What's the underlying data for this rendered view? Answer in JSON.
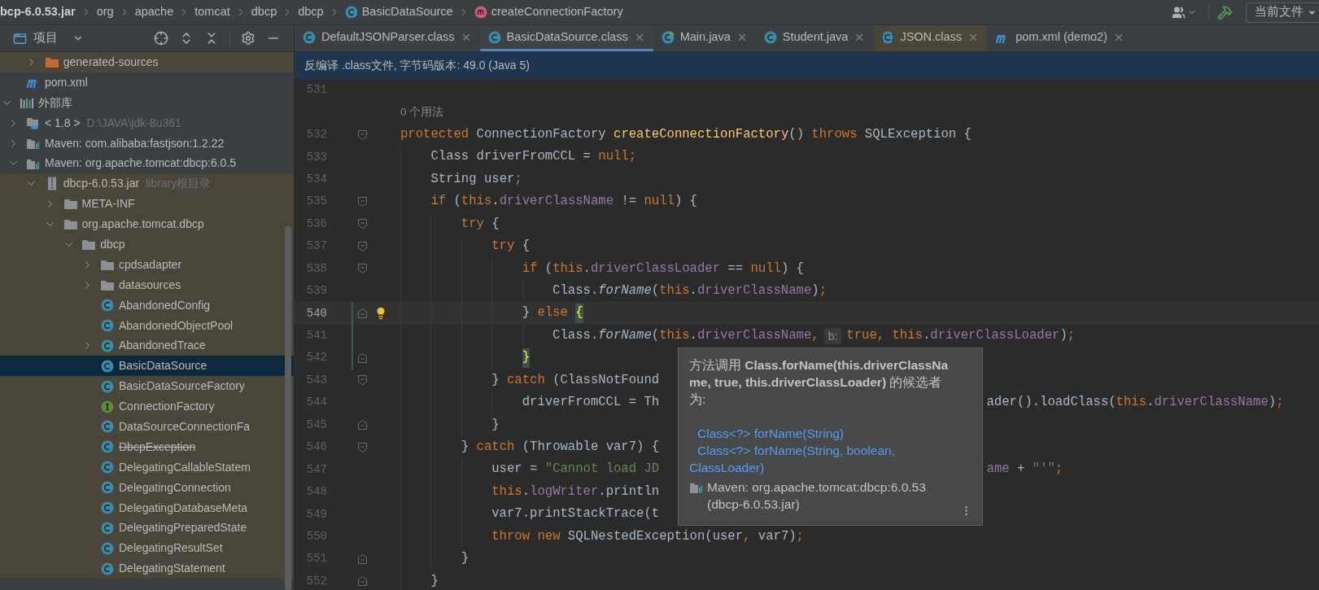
{
  "breadcrumb": [
    {
      "label": "bcp-6.0.53.jar",
      "kind": "jar"
    },
    {
      "label": "org",
      "kind": "package"
    },
    {
      "label": "apache",
      "kind": "package"
    },
    {
      "label": "tomcat",
      "kind": "package"
    },
    {
      "label": "dbcp",
      "kind": "package"
    },
    {
      "label": "dbcp",
      "kind": "package"
    },
    {
      "label": "BasicDataSource",
      "kind": "class"
    },
    {
      "label": "createConnectionFactory",
      "kind": "method"
    }
  ],
  "toolbar": {
    "scope": "当前文件"
  },
  "project_panel": {
    "title": "项目",
    "tree": [
      {
        "children": [
          {
            "children": [
              {
                "label": "generated-sources",
                "kind": "source-folder",
                "expanded": false,
                "selected": false,
                "tinted": true
              }
            ]
          },
          {
            "label": "pom.xml",
            "kind": "maven",
            "selected": false,
            "tinted": false
          }
        ]
      },
      {
        "label": "外部库",
        "kind": "libraries",
        "expanded": true,
        "selected": false,
        "tinted": false,
        "children": [
          {
            "label": "< 1.8 >",
            "hint": "D:\\JAVA\\jdk-8u361",
            "kind": "jdk",
            "expanded": false,
            "selected": false,
            "tinted": false
          },
          {
            "label": "Maven: com.alibaba:fastjson:1.2.22",
            "kind": "library",
            "expanded": false,
            "selected": false,
            "tinted": false
          },
          {
            "label": "Maven: org.apache.tomcat:dbcp:6.0.5",
            "kind": "library",
            "expanded": true,
            "selected": false,
            "tinted": false,
            "children": [
              {
                "label": "dbcp-6.0.53.jar",
                "hint": "library根目录",
                "kind": "jar",
                "expanded": true,
                "selected": false,
                "tinted": true,
                "children": [
                  {
                    "label": "META-INF",
                    "kind": "folder",
                    "expanded": false,
                    "selected": false,
                    "tinted": true
                  },
                  {
                    "label": "org.apache.tomcat.dbcp",
                    "kind": "folder",
                    "expanded": true,
                    "selected": false,
                    "tinted": true,
                    "children": [
                      {
                        "label": "dbcp",
                        "kind": "folder",
                        "expanded": true,
                        "selected": false,
                        "tinted": true,
                        "children": [
                          {
                            "label": "cpdsadapter",
                            "kind": "folder",
                            "expanded": false,
                            "selected": false,
                            "tinted": true
                          },
                          {
                            "label": "datasources",
                            "kind": "folder",
                            "expanded": false,
                            "selected": false,
                            "tinted": true
                          },
                          {
                            "label": "AbandonedConfig",
                            "kind": "class",
                            "selected": false,
                            "tinted": true,
                            "deprecated": false
                          },
                          {
                            "label": "AbandonedObjectPool",
                            "kind": "class",
                            "selected": false,
                            "tinted": true,
                            "deprecated": false
                          },
                          {
                            "label": "AbandonedTrace",
                            "kind": "class",
                            "expanded": false,
                            "selected": false,
                            "tinted": true,
                            "deprecated": false
                          },
                          {
                            "label": "BasicDataSource",
                            "kind": "class",
                            "selected": true,
                            "deprecated": false
                          },
                          {
                            "label": "BasicDataSourceFactory",
                            "kind": "class",
                            "selected": false,
                            "tinted": true,
                            "deprecated": false
                          },
                          {
                            "label": "ConnectionFactory",
                            "kind": "interface",
                            "selected": false,
                            "tinted": true,
                            "deprecated": false
                          },
                          {
                            "label": "DataSourceConnectionFa",
                            "kind": "class",
                            "selected": false,
                            "tinted": true,
                            "deprecated": false
                          },
                          {
                            "label": "DbcpException",
                            "kind": "class",
                            "selected": false,
                            "tinted": true,
                            "deprecated": true
                          },
                          {
                            "label": "DelegatingCallableStatem",
                            "kind": "class",
                            "selected": false,
                            "tinted": true,
                            "deprecated": false
                          },
                          {
                            "label": "DelegatingConnection",
                            "kind": "class",
                            "selected": false,
                            "tinted": true,
                            "deprecated": false
                          },
                          {
                            "label": "DelegatingDatabaseMeta",
                            "kind": "class",
                            "selected": false,
                            "tinted": true,
                            "deprecated": false
                          },
                          {
                            "label": "DelegatingPreparedState",
                            "kind": "class",
                            "selected": false,
                            "tinted": true,
                            "deprecated": false
                          },
                          {
                            "label": "DelegatingResultSet",
                            "kind": "class",
                            "selected": false,
                            "tinted": true,
                            "deprecated": false
                          },
                          {
                            "label": "DelegatingStatement",
                            "kind": "class",
                            "selected": false,
                            "tinted": true,
                            "deprecated": false
                          }
                        ]
                      }
                    ]
                  }
                ]
              }
            ]
          }
        ]
      }
    ]
  },
  "tabs": [
    {
      "label": "DefaultJSONParser.class",
      "kind": "class",
      "selected": false,
      "tinted": false
    },
    {
      "label": "BasicDataSource.class",
      "kind": "class",
      "selected": true,
      "tinted": false
    },
    {
      "label": "Main.java",
      "kind": "runnable-class",
      "selected": false,
      "tinted": false
    },
    {
      "label": "Student.java",
      "kind": "class",
      "selected": false,
      "tinted": false
    },
    {
      "label": "JSON.class",
      "kind": "library-class",
      "selected": false,
      "tinted": true
    },
    {
      "label": "pom.xml (demo2)",
      "kind": "maven",
      "selected": false,
      "tinted": false
    }
  ],
  "banner": "反编译 .class文件, 字节码版本: 49.0 (Java 5)",
  "editor": {
    "lines": [
      {
        "kind": "code",
        "number": "531"
      },
      {
        "kind": "usages",
        "text": "0 个用法"
      },
      {
        "kind": "code",
        "number": "532",
        "fold_start": true,
        "tokens": [
          {
            "kind": "keyword",
            "text": "protected"
          },
          {
            "kind": "plain",
            "text": " ConnectionFactory "
          },
          {
            "kind": "method",
            "text": "createConnectionFactory"
          },
          {
            "kind": "plain",
            "text": "() "
          },
          {
            "kind": "keyword",
            "text": "throws"
          },
          {
            "kind": "plain",
            "text": " SQLException {"
          }
        ]
      },
      {
        "kind": "code",
        "number": "533",
        "tokens": [
          {
            "kind": "plain",
            "text": "    Class driverFromCCL = "
          },
          {
            "kind": "keyword",
            "text": "null;"
          }
        ]
      },
      {
        "kind": "code",
        "number": "534",
        "tokens": [
          {
            "kind": "plain",
            "text": "    String user"
          },
          {
            "kind": "keyword",
            "text": ";"
          }
        ]
      },
      {
        "kind": "code",
        "number": "535",
        "fold_start": true,
        "tokens": [
          {
            "kind": "keyword",
            "text": "    if"
          },
          {
            "kind": "plain",
            "text": " ("
          },
          {
            "kind": "keyword",
            "text": "this"
          },
          {
            "kind": "plain",
            "text": "."
          },
          {
            "kind": "field",
            "text": "driverClassName"
          },
          {
            "kind": "plain",
            "text": " != "
          },
          {
            "kind": "keyword",
            "text": "null"
          },
          {
            "kind": "plain",
            "text": ") {"
          }
        ]
      },
      {
        "kind": "code",
        "number": "536",
        "fold_start": true,
        "tokens": [
          {
            "kind": "keyword",
            "text": "        try"
          },
          {
            "kind": "plain",
            "text": " {"
          }
        ]
      },
      {
        "kind": "code",
        "number": "537",
        "fold_start": true,
        "tokens": [
          {
            "kind": "keyword",
            "text": "            try"
          },
          {
            "kind": "plain",
            "text": " {"
          }
        ]
      },
      {
        "kind": "code",
        "number": "538",
        "fold_start": true,
        "tokens": [
          {
            "kind": "keyword",
            "text": "                if"
          },
          {
            "kind": "plain",
            "text": " ("
          },
          {
            "kind": "keyword",
            "text": "this"
          },
          {
            "kind": "plain",
            "text": "."
          },
          {
            "kind": "field",
            "text": "driverClassLoader"
          },
          {
            "kind": "plain",
            "text": " == "
          },
          {
            "kind": "keyword",
            "text": "null"
          },
          {
            "kind": "plain",
            "text": ") {"
          }
        ]
      },
      {
        "kind": "code",
        "number": "539",
        "tokens": [
          {
            "kind": "plain",
            "text": "                    Class."
          },
          {
            "kind": "static",
            "text": "forName"
          },
          {
            "kind": "plain",
            "text": "("
          },
          {
            "kind": "keyword",
            "text": "this"
          },
          {
            "kind": "plain",
            "text": "."
          },
          {
            "kind": "field",
            "text": "driverClassName"
          },
          {
            "kind": "plain",
            "text": ")"
          },
          {
            "kind": "keyword",
            "text": ";"
          }
        ]
      },
      {
        "kind": "code",
        "number": "540",
        "fold_end": true,
        "current": true,
        "bulb": true,
        "changed": true,
        "tokens": [
          {
            "kind": "plain",
            "text": "                } "
          },
          {
            "kind": "keyword",
            "text": "else "
          },
          {
            "kind": "brace",
            "text": "{"
          }
        ]
      },
      {
        "kind": "code",
        "number": "541",
        "changed": true,
        "tokens": [
          {
            "kind": "plain",
            "text": "                    Class."
          },
          {
            "kind": "static",
            "text": "forName"
          },
          {
            "kind": "plain",
            "text": "("
          },
          {
            "kind": "keyword",
            "text": "this"
          },
          {
            "kind": "plain",
            "text": "."
          },
          {
            "kind": "field",
            "text": "driverClassName"
          },
          {
            "kind": "keyword",
            "text": ","
          },
          {
            "kind": "hint",
            "text": "b:"
          },
          {
            "kind": "keyword",
            "text": "true, this"
          },
          {
            "kind": "plain",
            "text": "."
          },
          {
            "kind": "field",
            "text": "driverClassLoader"
          },
          {
            "kind": "plain",
            "text": ")"
          },
          {
            "kind": "keyword",
            "text": ";"
          }
        ]
      },
      {
        "kind": "code",
        "number": "542",
        "fold_end": true,
        "changed": true,
        "tokens": [
          {
            "kind": "brace",
            "text": "                }"
          }
        ]
      },
      {
        "kind": "code",
        "number": "543",
        "fold_start": true,
        "tokens": [
          {
            "kind": "plain",
            "text": "            } "
          },
          {
            "kind": "keyword",
            "text": "catch"
          },
          {
            "kind": "plain",
            "text": " (ClassNotFound"
          }
        ]
      },
      {
        "kind": "code",
        "number": "544",
        "tokens": [
          {
            "kind": "plain",
            "text": "                driverFromCCL = Th"
          },
          {
            "kind": "gap"
          },
          {
            "kind": "plain",
            "text": "ader().loadClass("
          },
          {
            "kind": "keyword",
            "text": "this"
          },
          {
            "kind": "plain",
            "text": "."
          },
          {
            "kind": "field",
            "text": "driverClassName"
          },
          {
            "kind": "plain",
            "text": ")"
          },
          {
            "kind": "keyword",
            "text": ";"
          }
        ]
      },
      {
        "kind": "code",
        "number": "545",
        "fold_end": true,
        "tokens": [
          {
            "kind": "plain",
            "text": "            }"
          }
        ]
      },
      {
        "kind": "code",
        "number": "546",
        "fold_start": true,
        "tokens": [
          {
            "kind": "plain",
            "text": "        } "
          },
          {
            "kind": "keyword",
            "text": "catch"
          },
          {
            "kind": "plain",
            "text": " (Throwable var7) {"
          }
        ]
      },
      {
        "kind": "code",
        "number": "547",
        "tokens": [
          {
            "kind": "plain",
            "text": "            user = "
          },
          {
            "kind": "string",
            "text": "\"Cannot load JD"
          },
          {
            "kind": "gap"
          },
          {
            "kind": "field",
            "text": "ame"
          },
          {
            "kind": "plain",
            "text": " + "
          },
          {
            "kind": "string",
            "text": "\"'\""
          },
          {
            "kind": "keyword",
            "text": ";"
          }
        ]
      },
      {
        "kind": "code",
        "number": "548",
        "tokens": [
          {
            "kind": "keyword",
            "text": "            this"
          },
          {
            "kind": "plain",
            "text": "."
          },
          {
            "kind": "field",
            "text": "logWriter"
          },
          {
            "kind": "plain",
            "text": ".println"
          }
        ]
      },
      {
        "kind": "code",
        "number": "549",
        "tokens": [
          {
            "kind": "plain",
            "text": "            var7.printStackTrace(t"
          }
        ]
      },
      {
        "kind": "code",
        "number": "550",
        "tokens": [
          {
            "kind": "keyword",
            "text": "            throw new"
          },
          {
            "kind": "plain",
            "text": " SQLNestedException(user"
          },
          {
            "kind": "keyword",
            "text": ","
          },
          {
            "kind": "plain",
            "text": " var7)"
          },
          {
            "kind": "keyword",
            "text": ";"
          }
        ]
      },
      {
        "kind": "code",
        "number": "551",
        "fold_end": true,
        "tokens": [
          {
            "kind": "plain",
            "text": "        }"
          }
        ]
      },
      {
        "kind": "code",
        "number": "552",
        "fold_end": true,
        "tokens": [
          {
            "kind": "plain",
            "text": "    }"
          }
        ]
      }
    ]
  },
  "popup": {
    "message": "方法调用 **Class.forName(this.driverClassName, true, this.driverClassLoader)** 的候选者为:",
    "candidates": [
      "Class<?> forName(String)",
      "Class<?> forName(String, boolean, ClassLoader)"
    ],
    "source": "Maven: org.apache.tomcat:dbcp:6.0.53 (dbcp-6.0.53.jar)"
  }
}
